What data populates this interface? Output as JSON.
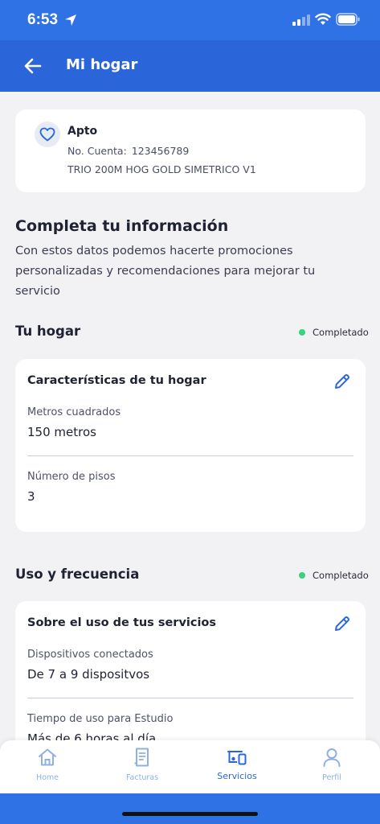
{
  "status_bar": {
    "time": "6:53"
  },
  "header": {
    "title": "Mi hogar"
  },
  "account": {
    "name": "Apto",
    "account_label": "No. Cuenta:",
    "account_number": "123456789",
    "plan": "TRIO 200M HOG GOLD SIMETRICO V1"
  },
  "info_section": {
    "title": "Completa tu información",
    "description": "Con estos datos podemos hacerte promociones personalizadas y recomendaciones para mejorar tu servicio"
  },
  "hogar": {
    "title": "Tu hogar",
    "status": "Completado",
    "card_title": "Características de tu hogar",
    "fields": [
      {
        "label": "Metros cuadrados",
        "value": "150 metros"
      },
      {
        "label": "Número de pisos",
        "value": "3"
      }
    ]
  },
  "uso": {
    "title": "Uso y frecuencia",
    "status": "Completado",
    "card_title": "Sobre el uso de tus servicios",
    "fields": [
      {
        "label": "Dispositivos conectados",
        "value": "De 7 a 9 dispositvos"
      },
      {
        "label": "Tiempo de uso para Estudio",
        "value": "Más de 6 horas al día"
      }
    ]
  },
  "bottom_nav": {
    "items": [
      {
        "label": "Home",
        "icon": "home-icon"
      },
      {
        "label": "Facturas",
        "icon": "receipt-icon"
      },
      {
        "label": "Servicios",
        "icon": "devices-icon"
      },
      {
        "label": "Perfil",
        "icon": "user-icon"
      }
    ],
    "active_index": 2
  },
  "colors": {
    "brand_blue": "#2a66d9",
    "status_green": "#37d47a",
    "background": "#f2f2f4"
  }
}
